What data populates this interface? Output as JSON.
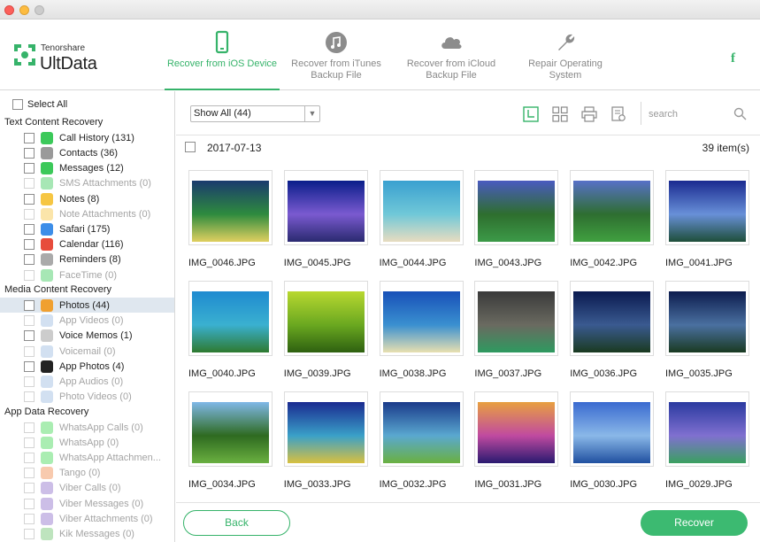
{
  "brand": {
    "company": "Tenorshare",
    "product": "UltData"
  },
  "nav": [
    {
      "label": "Recover from iOS Device",
      "icon": "phone-icon",
      "active": true
    },
    {
      "label": "Recover from iTunes Backup File",
      "icon": "music-icon",
      "active": false
    },
    {
      "label": "Recover from iCloud Backup File",
      "icon": "cloud-icon",
      "active": false
    },
    {
      "label": "Repair Operating System",
      "icon": "wrench-icon",
      "active": false
    }
  ],
  "facebook": "f",
  "sidebar": {
    "select_all": "Select All",
    "sections": [
      {
        "title": "Text Content Recovery",
        "items": [
          {
            "label": "Call History (131)",
            "icon": "phone-call-icon",
            "color": "#3cc95a",
            "enabled": true
          },
          {
            "label": "Contacts (36)",
            "icon": "contacts-icon",
            "color": "#9a9a9a",
            "enabled": true
          },
          {
            "label": "Messages (12)",
            "icon": "messages-icon",
            "color": "#3cc95a",
            "enabled": true
          },
          {
            "label": "SMS Attachments (0)",
            "icon": "sms-attachment-icon",
            "color": "#3cc95a",
            "enabled": false
          },
          {
            "label": "Notes (8)",
            "icon": "notes-icon",
            "color": "#f6c643",
            "enabled": true
          },
          {
            "label": "Note Attachments (0)",
            "icon": "note-attachment-icon",
            "color": "#f6c643",
            "enabled": false
          },
          {
            "label": "Safari (175)",
            "icon": "safari-icon",
            "color": "#3d8ee8",
            "enabled": true
          },
          {
            "label": "Calendar (116)",
            "icon": "calendar-icon",
            "color": "#e74c3c",
            "enabled": true
          },
          {
            "label": "Reminders (8)",
            "icon": "reminders-icon",
            "color": "#aaaaaa",
            "enabled": true
          },
          {
            "label": "FaceTime (0)",
            "icon": "facetime-icon",
            "color": "#3cc95a",
            "enabled": false
          }
        ]
      },
      {
        "title": "Media Content Recovery",
        "items": [
          {
            "label": "Photos (44)",
            "icon": "photos-icon",
            "color": "#f0a030",
            "enabled": true,
            "selected": true
          },
          {
            "label": "App Videos (0)",
            "icon": "app-videos-icon",
            "color": "#9bbbe0",
            "enabled": false
          },
          {
            "label": "Voice Memos (1)",
            "icon": "voice-memos-icon",
            "color": "#cccccc",
            "enabled": true
          },
          {
            "label": "Voicemail (0)",
            "icon": "voicemail-icon",
            "color": "#9bbbe0",
            "enabled": false
          },
          {
            "label": "App Photos (4)",
            "icon": "app-photos-icon",
            "color": "#222222",
            "enabled": true
          },
          {
            "label": "App Audios (0)",
            "icon": "app-audios-icon",
            "color": "#9bbbe0",
            "enabled": false
          },
          {
            "label": "Photo Videos (0)",
            "icon": "photo-videos-icon",
            "color": "#9bbbe0",
            "enabled": false
          }
        ]
      },
      {
        "title": "App Data Recovery",
        "items": [
          {
            "label": "WhatsApp Calls (0)",
            "icon": "whatsapp-icon",
            "color": "#43d854",
            "enabled": false
          },
          {
            "label": "WhatsApp (0)",
            "icon": "whatsapp-icon",
            "color": "#43d854",
            "enabled": false
          },
          {
            "label": "WhatsApp Attachmen...",
            "icon": "whatsapp-icon",
            "color": "#43d854",
            "enabled": false
          },
          {
            "label": "Tango (0)",
            "icon": "tango-icon",
            "color": "#f08a4b",
            "enabled": false
          },
          {
            "label": "Viber Calls (0)",
            "icon": "viber-icon",
            "color": "#8e6fc9",
            "enabled": false
          },
          {
            "label": "Viber Messages (0)",
            "icon": "viber-icon",
            "color": "#8e6fc9",
            "enabled": false
          },
          {
            "label": "Viber Attachments (0)",
            "icon": "viber-icon",
            "color": "#8e6fc9",
            "enabled": false
          },
          {
            "label": "Kik Messages (0)",
            "icon": "kik-icon",
            "color": "#6ec46e",
            "enabled": false
          }
        ]
      }
    ]
  },
  "toolbar": {
    "filter_value": "Show All (44)",
    "search_placeholder": "search"
  },
  "content": {
    "date": "2017-07-13",
    "item_count": "39 item(s)",
    "photos": [
      {
        "name": "IMG_0046.JPG",
        "colors": [
          "#1a3a6e",
          "#2e8b3e",
          "#e0d060"
        ]
      },
      {
        "name": "IMG_0045.JPG",
        "colors": [
          "#0a1e8a",
          "#7a5ad0",
          "#2a2a70"
        ]
      },
      {
        "name": "IMG_0044.JPG",
        "colors": [
          "#3aa0d0",
          "#70c8d8",
          "#e8dcc0"
        ]
      },
      {
        "name": "IMG_0043.JPG",
        "colors": [
          "#4a5ac0",
          "#2e6e2e",
          "#3c9a48"
        ]
      },
      {
        "name": "IMG_0042.JPG",
        "colors": [
          "#5870c8",
          "#2e6e30",
          "#40a040"
        ]
      },
      {
        "name": "IMG_0041.JPG",
        "colors": [
          "#1a2a90",
          "#6890d8",
          "#1e4e3a"
        ]
      },
      {
        "name": "IMG_0040.JPG",
        "colors": [
          "#1f8ad0",
          "#3ab0d0",
          "#2e7a30"
        ]
      },
      {
        "name": "IMG_0039.JPG",
        "colors": [
          "#b8d830",
          "#6aa820",
          "#2e6010"
        ]
      },
      {
        "name": "IMG_0038.JPG",
        "colors": [
          "#1850b8",
          "#3a90d0",
          "#e8e0b0"
        ]
      },
      {
        "name": "IMG_0037.JPG",
        "colors": [
          "#3a3a3a",
          "#6a6a60",
          "#2e9a60"
        ]
      },
      {
        "name": "IMG_0036.JPG",
        "colors": [
          "#0a1a50",
          "#3a5a90",
          "#1a3a20"
        ]
      },
      {
        "name": "IMG_0035.JPG",
        "colors": [
          "#0c1c4e",
          "#4a70a0",
          "#1a3a22"
        ]
      },
      {
        "name": "IMG_0034.JPG",
        "colors": [
          "#80b8e8",
          "#2e6a20",
          "#6ab040"
        ]
      },
      {
        "name": "IMG_0033.JPG",
        "colors": [
          "#1a2a90",
          "#3aa0c8",
          "#d8c040"
        ]
      },
      {
        "name": "IMG_0032.JPG",
        "colors": [
          "#1a3a8a",
          "#5aa8d0",
          "#6ab040"
        ]
      },
      {
        "name": "IMG_0031.JPG",
        "colors": [
          "#e8a040",
          "#c04aa0",
          "#2a1a70"
        ]
      },
      {
        "name": "IMG_0030.JPG",
        "colors": [
          "#3a6ad0",
          "#8ab8e8",
          "#2050a0"
        ]
      },
      {
        "name": "IMG_0029.JPG",
        "colors": [
          "#2a3aa0",
          "#8070d0",
          "#3aa060"
        ]
      }
    ]
  },
  "buttons": {
    "back": "Back",
    "recover": "Recover"
  },
  "accent": "#36b36a"
}
